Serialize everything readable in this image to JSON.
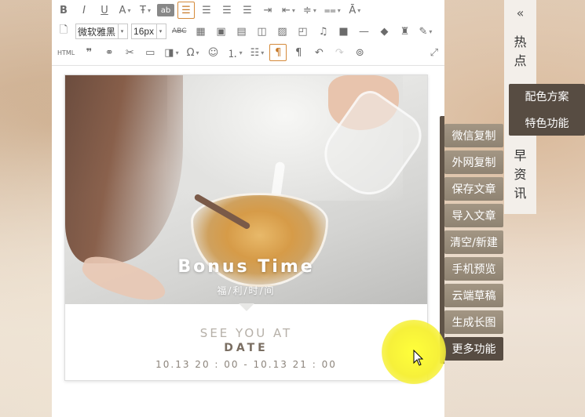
{
  "toolbar": {
    "row1": [
      "B",
      "I",
      "U",
      "A",
      "T",
      "ab",
      "≡",
      "≡",
      "≡",
      "≡",
      "⇥",
      "⇤",
      "≑",
      "≑",
      "A"
    ],
    "font_family": "微软雅黑",
    "font_size": "16px",
    "abc_label": "ABC",
    "html_label": "HTML"
  },
  "card": {
    "title": "Bonus Time",
    "subtitle": "福/利/时/间",
    "see_you": "SEE YOU AT",
    "date_label": "DATE",
    "date_range": "10.13 20 : 00 - 10.13 21 : 00"
  },
  "side_tools": [
    {
      "label": "微信复制"
    },
    {
      "label": "外网复制"
    },
    {
      "label": "保存文章"
    },
    {
      "label": "导入文章"
    },
    {
      "label": "清空/新建"
    },
    {
      "label": "手机预览"
    },
    {
      "label": "云端草稿"
    },
    {
      "label": "生成长图"
    },
    {
      "label": "更多功能"
    }
  ],
  "rail": {
    "collapse": "«",
    "hot": [
      "热",
      "点"
    ],
    "morning_news": [
      "早",
      "资",
      "讯"
    ]
  },
  "popup": {
    "items": [
      "配色方案",
      "特色功能"
    ]
  },
  "colors": {
    "accent": "#d58a3a",
    "side_button": "#9a8d7b",
    "side_button_dark": "#574c42",
    "highlight": "#f6f03a"
  }
}
